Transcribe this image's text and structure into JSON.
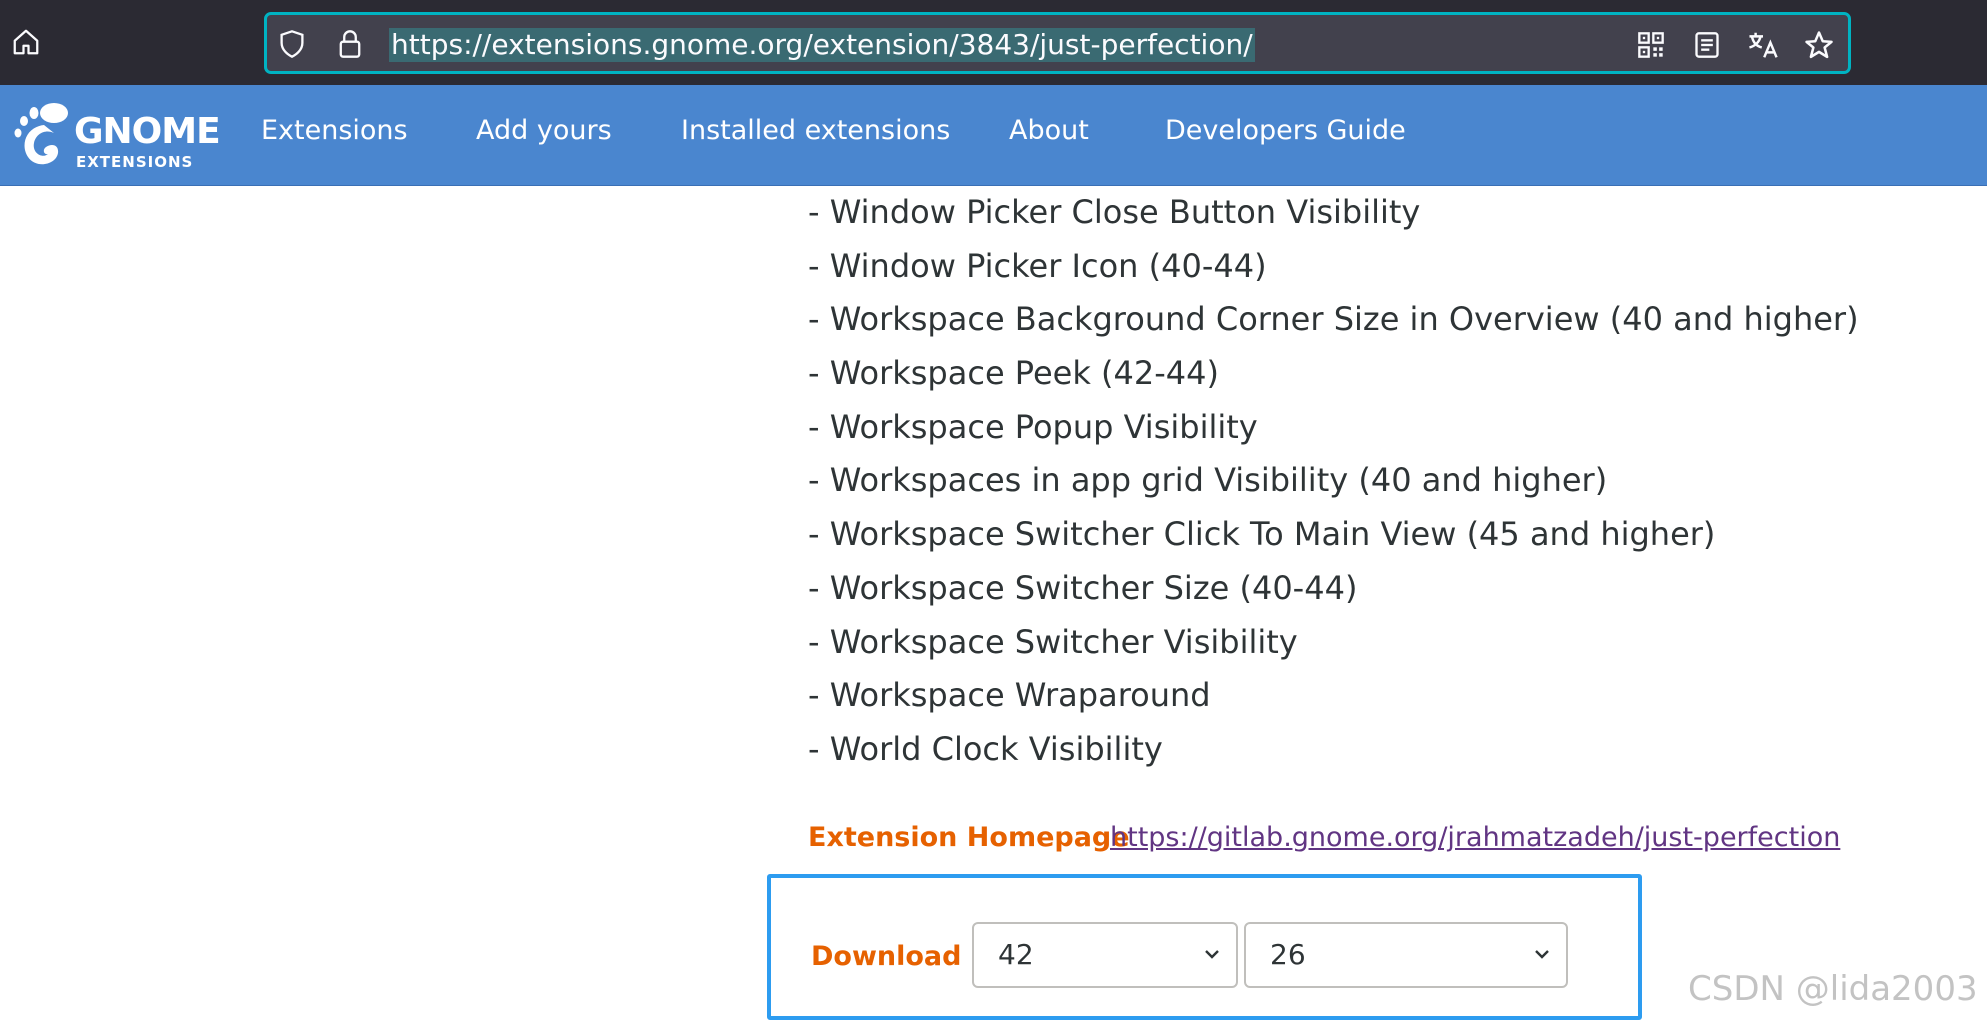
{
  "browser": {
    "url": "https://extensions.gnome.org/extension/3843/just-perfection/",
    "icons": [
      "home-icon",
      "shield-icon",
      "lock-icon",
      "qr-code-icon",
      "reader-view-icon",
      "translate-icon",
      "bookmark-star-icon"
    ]
  },
  "header": {
    "logo_word": "GNOME",
    "logo_sub": "EXTENSIONS",
    "nav": [
      "Extensions",
      "Add yours",
      "Installed extensions",
      "About",
      "Developers Guide"
    ],
    "background": "#4a86cf"
  },
  "features": [
    "- Window Picker Close Button Visibility",
    "- Window Picker Icon (40-44)",
    "- Workspace Background Corner Size in Overview (40 and higher)",
    "- Workspace Peek (42-44)",
    "- Workspace Popup Visibility",
    "- Workspaces in app grid Visibility (40 and higher)",
    "- Workspace Switcher Click To Main View (45 and higher)",
    "- Workspace Switcher Size (40-44)",
    "- Workspace Switcher Visibility",
    "- Workspace Wraparound",
    "- World Clock Visibility"
  ],
  "homepage": {
    "label": "Extension Homepage",
    "link": "https://gitlab.gnome.org/jrahmatzadeh/just-perfection"
  },
  "download": {
    "label": "Download",
    "shell_version": "42",
    "extension_version": "26",
    "highlight_color": "#2d9cf0"
  },
  "watermark": "CSDN @lida2003"
}
